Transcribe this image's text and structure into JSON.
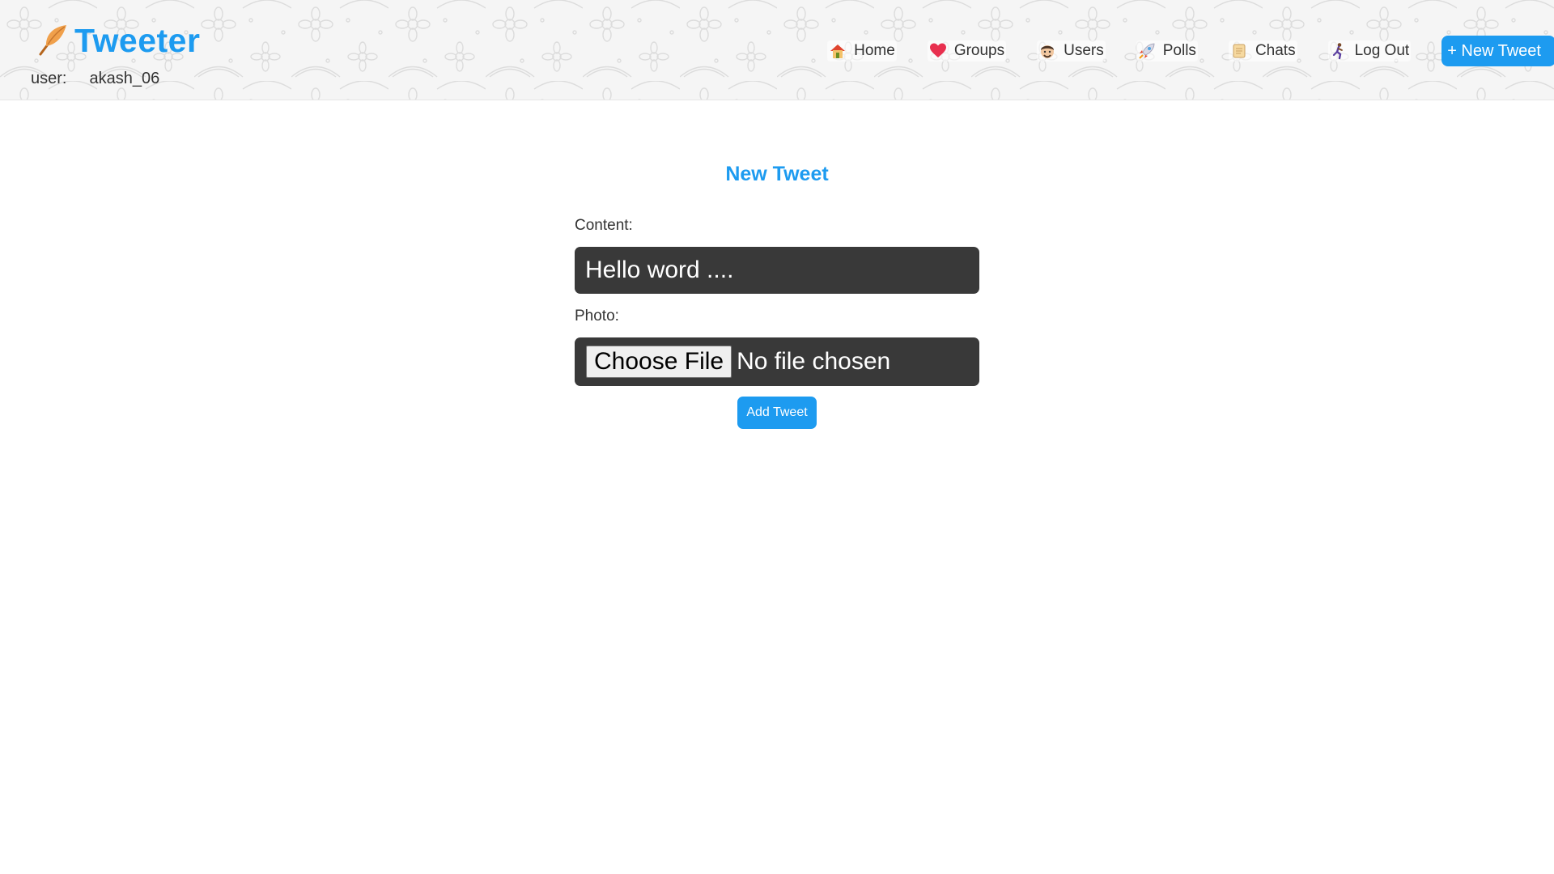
{
  "app": {
    "title": "Tweeter",
    "brand_color": "#1d9bf0",
    "logo_icon": "feather-icon"
  },
  "user": {
    "label": "user:",
    "name": "akash_06"
  },
  "nav": {
    "items": [
      {
        "label": "Home",
        "icon": "house-icon"
      },
      {
        "label": "Groups",
        "icon": "heart-icon"
      },
      {
        "label": "Users",
        "icon": "face-icon"
      },
      {
        "label": "Polls",
        "icon": "rocket-icon"
      },
      {
        "label": "Chats",
        "icon": "scroll-icon"
      },
      {
        "label": "Log Out",
        "icon": "running-person-icon"
      }
    ],
    "new_tweet_label": "+ New Tweet"
  },
  "form": {
    "title": "New Tweet",
    "content_label": "Content:",
    "content_value": "Hello word ....",
    "photo_label": "Photo:",
    "choose_file_label": "Choose File",
    "file_status": "No file chosen",
    "submit_label": "Add Tweet",
    "input_bg": "#393939"
  }
}
